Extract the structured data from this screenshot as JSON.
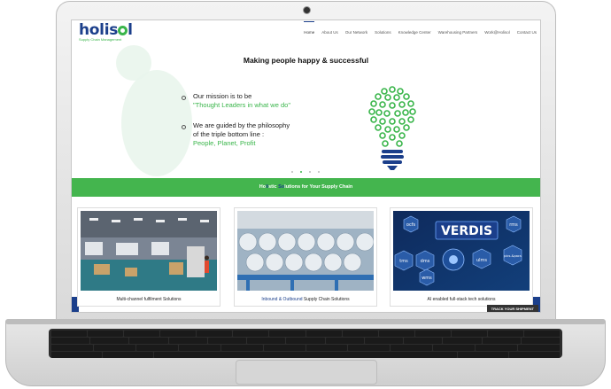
{
  "site": {
    "logo_text": "holis",
    "logo_text_end": "l",
    "logo_tagline": "Supply Chain Management"
  },
  "nav": {
    "items": [
      {
        "label": "Home",
        "active": true
      },
      {
        "label": "About Us"
      },
      {
        "label": "Our Network"
      },
      {
        "label": "Solutions"
      },
      {
        "label": "Knowledge Center"
      },
      {
        "label": "Warehousing Partners"
      },
      {
        "label": "Work@Holisol"
      },
      {
        "label": "Contact Us"
      }
    ]
  },
  "hero": {
    "title": "Making people happy & successful",
    "mission_line1": "Our mission is to be",
    "mission_line2": "\"Thought Leaders in what we do\"",
    "philosophy_line1": "We are guided by the philosophy",
    "philosophy_line2": "of the triple bottom line :",
    "philosophy_line3": "People, Planet, Profit"
  },
  "band": {
    "prefix_plain": "Ho",
    "prefix_hl": "li",
    "mid_plain": "stic ",
    "mid_hl": "So",
    "suffix": "lutions for Your Supply Chain"
  },
  "cards": [
    {
      "label": "Multi-channel fulfilment Solutions"
    },
    {
      "label_blue": "Inbound & Outbound",
      "label_rest": " Supply Chain Solutions"
    },
    {
      "label": "AI enabled full-stack tech solutions"
    }
  ],
  "track_button": "TRACK YOUR SHIPMENT",
  "verdis": {
    "title": "VERDIS",
    "chips": [
      "ocfs",
      "rms",
      "ulms",
      "tms",
      "dms",
      "wms",
      "pics-&pacs"
    ]
  },
  "colors": {
    "brand_blue": "#1b3f8b",
    "brand_green": "#39b54a",
    "band_green": "#44b54e"
  }
}
